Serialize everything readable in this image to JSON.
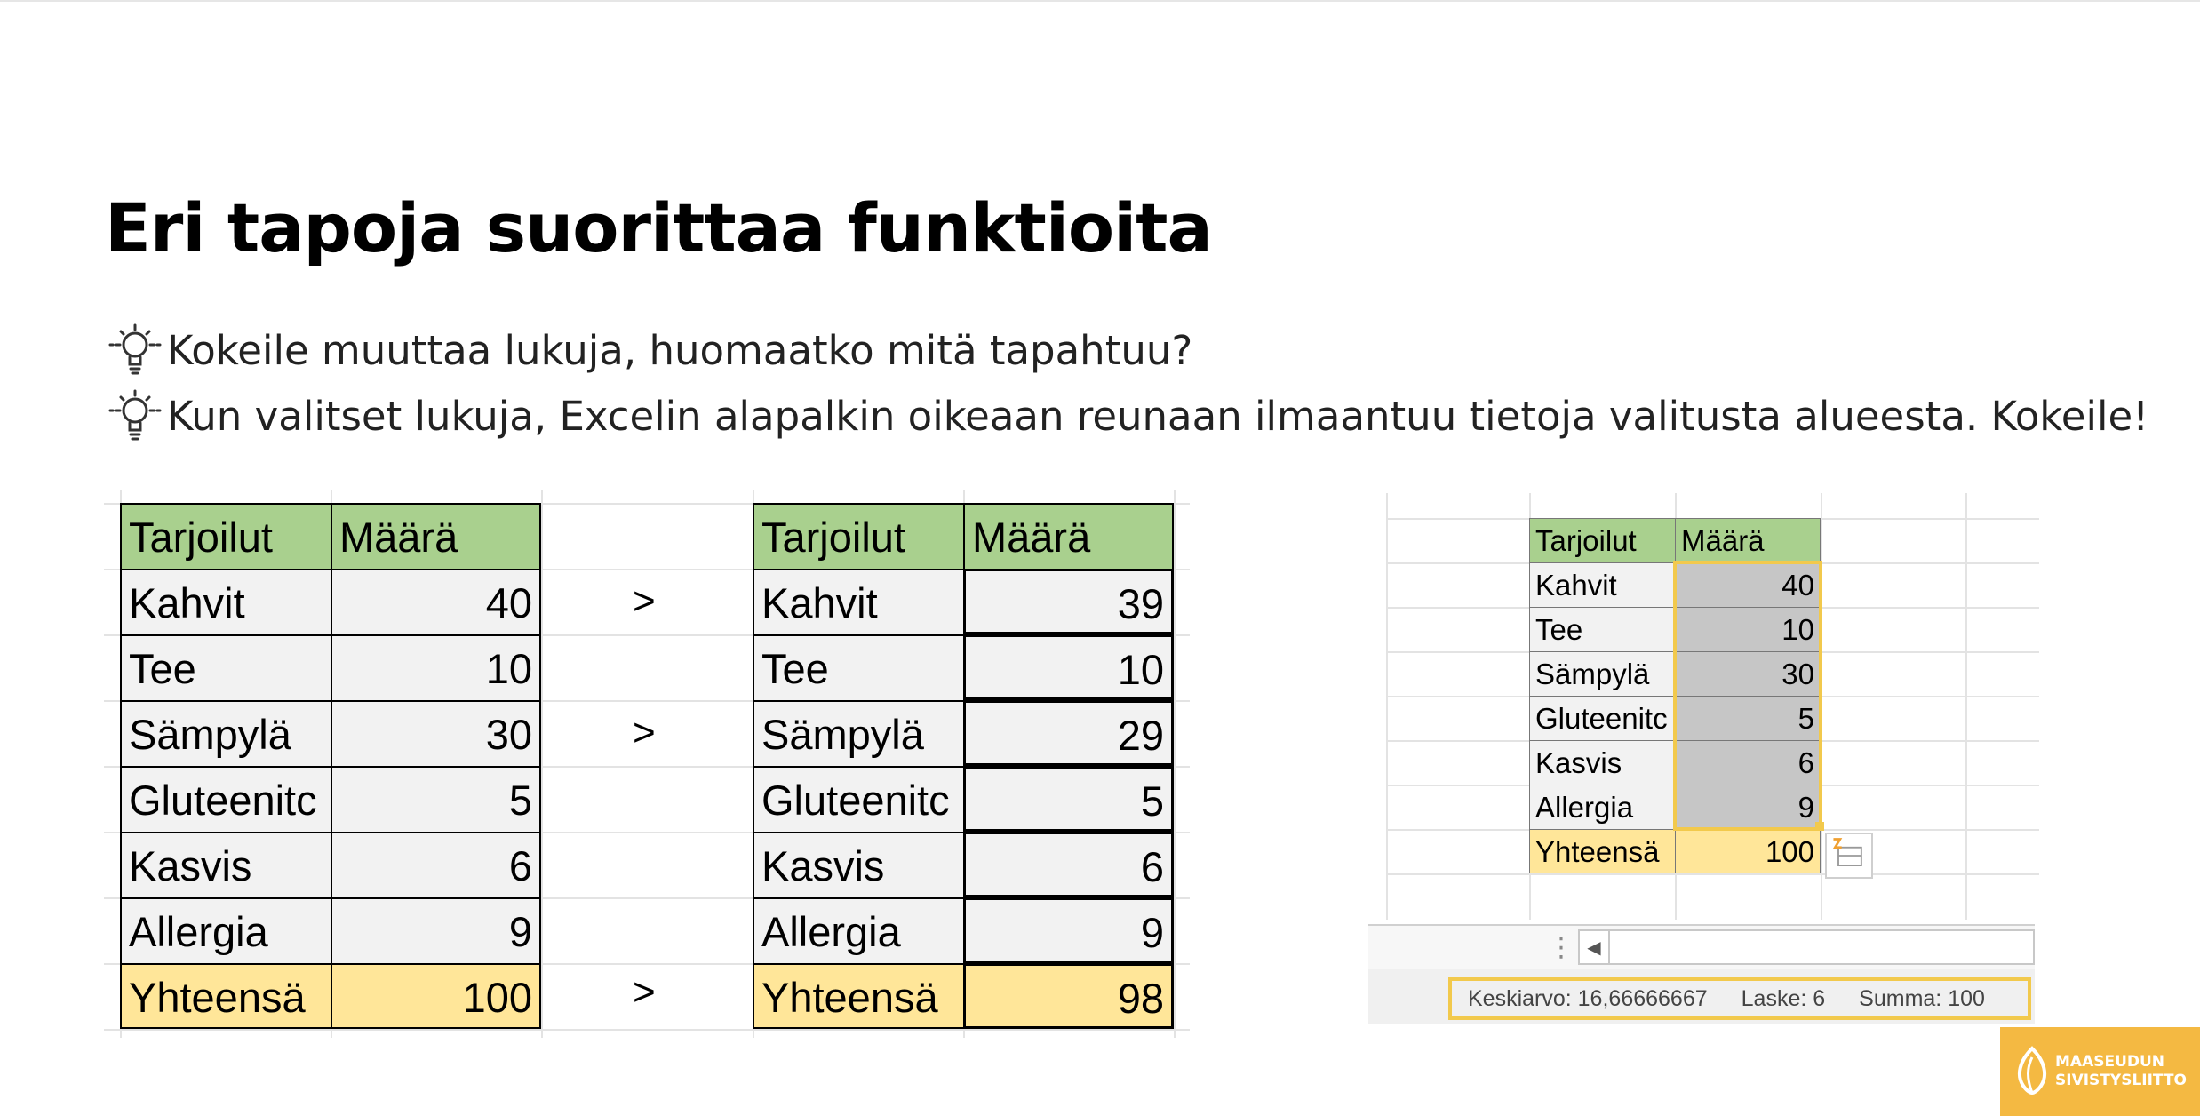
{
  "slide": {
    "title": "Eri tapoja suorittaa funktioita",
    "tips": [
      "Kokeile muuttaa lukuja, huomaatko mitä tapahtuu?",
      "Kun valitset lukuja, Excelin alapalkin oikeaan reunaan ilmaantuu tietoja valitusta alueesta. Kokeile!"
    ],
    "arrow_symbol": ">"
  },
  "table_before": {
    "headers": [
      "Tarjoilut",
      "Määrä"
    ],
    "rows": [
      [
        "Kahvit",
        "40"
      ],
      [
        "Tee",
        "10"
      ],
      [
        "Sämpylä",
        "30"
      ],
      [
        "Gluteenitc",
        "5"
      ],
      [
        "Kasvis",
        "6"
      ],
      [
        "Allergia",
        "9"
      ],
      [
        "Yhteensä",
        "100"
      ]
    ]
  },
  "table_after": {
    "headers": [
      "Tarjoilut",
      "Määrä"
    ],
    "rows": [
      [
        "Kahvit",
        "39"
      ],
      [
        "Tee",
        "10"
      ],
      [
        "Sämpylä",
        "29"
      ],
      [
        "Gluteenitc",
        "5"
      ],
      [
        "Kasvis",
        "6"
      ],
      [
        "Allergia",
        "9"
      ],
      [
        "Yhteensä",
        "98"
      ]
    ]
  },
  "excel_screenshot": {
    "headers": [
      "Tarjoilut",
      "Määrä"
    ],
    "rows": [
      [
        "Kahvit",
        "40"
      ],
      [
        "Tee",
        "10"
      ],
      [
        "Sämpylä",
        "30"
      ],
      [
        "Gluteenitc",
        "5"
      ],
      [
        "Kasvis",
        "6"
      ],
      [
        "Allergia",
        "9"
      ],
      [
        "Yhteensä",
        "100"
      ]
    ],
    "status": {
      "average": "Keskiarvo: 16,66666667",
      "count": "Laske: 6",
      "sum": "Summa: 100"
    },
    "selection_color": "#c6c6c6",
    "highlight_color": "#f2c94c"
  },
  "logo": {
    "line1": "MAASEUDUN",
    "line2": "SIVISTYSLIITTO",
    "color": "#f4b942"
  },
  "colors": {
    "header": "#a9d08e",
    "total": "#ffe699"
  }
}
